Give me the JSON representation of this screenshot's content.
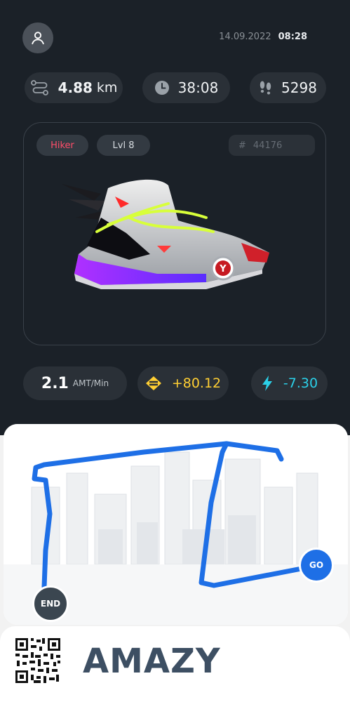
{
  "header": {
    "date": "14.09.2022",
    "time": "08:28"
  },
  "metrics": {
    "distance_value": "4.88",
    "distance_unit": "km",
    "duration": "38:08",
    "steps": "5298"
  },
  "sneaker": {
    "class_label": "Hiker",
    "level_label": "Lvl 8",
    "id_hash": "#",
    "id_value": "44176",
    "badge_letter": "Y"
  },
  "stats": {
    "rate_value": "2.1",
    "rate_unit": "AMT/Min",
    "earned": "+80.12",
    "energy": "-7.30"
  },
  "map": {
    "go_label": "GO",
    "end_label": "END"
  },
  "brand": {
    "name": "AMAZY"
  },
  "colors": {
    "background_dark": "#1b2128",
    "pill": "#2a3037",
    "class_tag": "#ff4d6a",
    "earned": "#ffcf33",
    "energy": "#2bd0e8",
    "route": "#1e6fe6",
    "brand": "#3d4f63"
  },
  "icons": [
    "user-icon",
    "route-icon",
    "clock-icon",
    "footsteps-icon",
    "token-icon",
    "lightning-icon",
    "qr-code"
  ]
}
